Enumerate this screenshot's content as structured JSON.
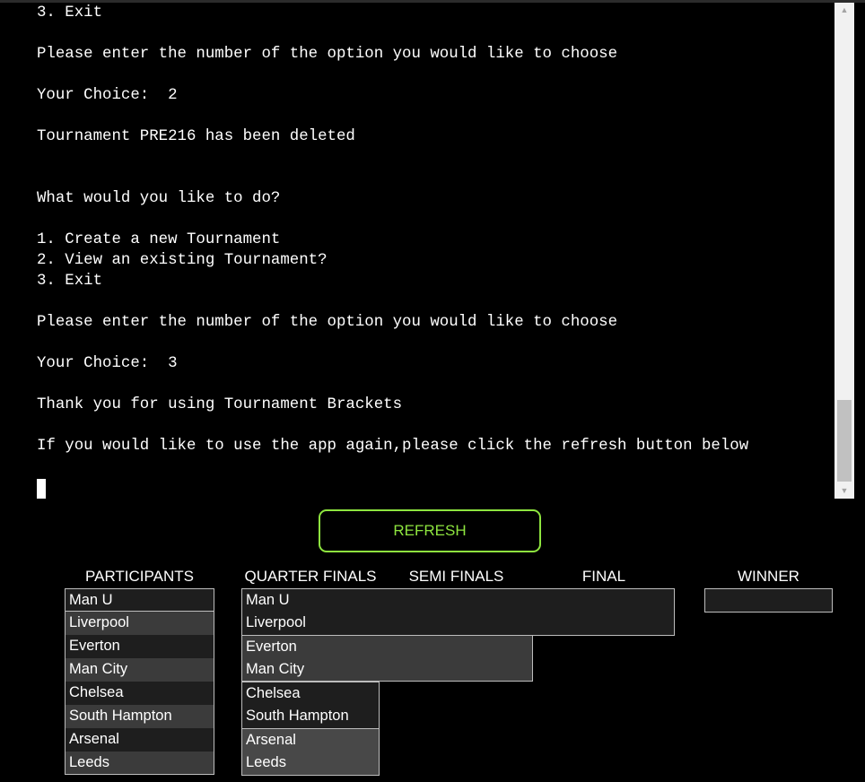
{
  "terminal": {
    "lines": [
      "3. Exit",
      "Please enter the number of the option you would like to choose",
      "Your Choice:  2",
      "Tournament PRE216 has been deleted",
      "What would you like to do?",
      "1. Create a new Tournament",
      "2. View an existing Tournament?",
      "3. Exit",
      "Please enter the number of the option you would like to choose",
      "Your Choice:  3",
      "Thank you for using Tournament Brackets",
      "If you would like to use the app again,please click the refresh button below"
    ]
  },
  "refresh_button": {
    "label": "REFRESH",
    "color": "#8ee53f"
  },
  "bracket": {
    "headers": {
      "participants": "PARTICIPANTS",
      "quarter_finals": "QUARTER FINALS",
      "semi_finals": "SEMI FINALS",
      "final": "FINAL",
      "winner": "WINNER"
    },
    "participants": [
      "Man U",
      "Liverpool",
      "Everton",
      "Man City",
      "Chelsea",
      "South Hampton",
      "Arsenal",
      "Leeds"
    ],
    "quarter_finals": [
      "Man U",
      "Liverpool",
      "Everton",
      "Man City",
      "Chelsea",
      "South Hampton",
      "Arsenal",
      "Leeds"
    ],
    "semi_finals": [
      "",
      "",
      "",
      ""
    ],
    "final": [
      "",
      ""
    ],
    "winner": ""
  },
  "colors": {
    "background": "#000000",
    "text": "#ffffff",
    "cell_dark": "#1e1e1e",
    "cell_medium": "#3b3b3b",
    "cell_light": "#484848",
    "cell_border": "#bdbdbd"
  }
}
